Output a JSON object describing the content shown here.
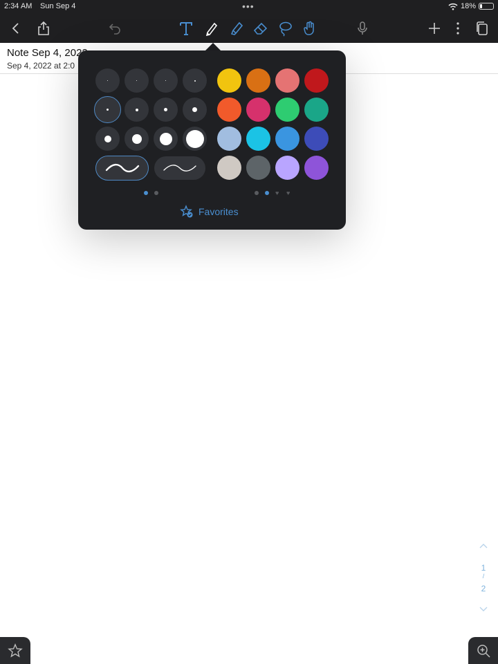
{
  "status": {
    "time": "2:34 AM",
    "date": "Sun Sep 4",
    "battery": "18%",
    "battery_level": 0.18
  },
  "toolbar": {
    "left": [
      "back-icon",
      "share-icon",
      "undo-icon"
    ],
    "tools": [
      "text-tool-icon",
      "pen-tool-icon",
      "highlighter-tool-icon",
      "eraser-tool-icon",
      "lasso-tool-icon",
      "hand-tool-icon"
    ],
    "selected_tool": "pen-tool-icon",
    "right": [
      "microphone-icon",
      "plus-icon",
      "more-icon",
      "pages-icon"
    ],
    "accent": "#4a8fd1"
  },
  "note": {
    "title": "Note Sep 4, 2022",
    "date": "Sep 4, 2022 at 2:0"
  },
  "popover": {
    "pen_sizes_selected": "row2-col1",
    "swatches": [
      [
        "#f1c40f",
        "#d97014",
        "#e57373",
        "#c0181c"
      ],
      [
        "#f15a2b",
        "#d6316c",
        "#2ecc71",
        "#1aa688"
      ],
      [
        "#a1bde0",
        "#1bc3e5",
        "#3a95e0",
        "#3d4cb8"
      ],
      [
        "#cfc9c3",
        "#5d6468",
        "#b9a5ff",
        "#8e54d9"
      ]
    ],
    "favorites_label": "Favorites",
    "pager_left": {
      "count": 2,
      "active": 0
    },
    "pager_right": {
      "count": 4,
      "active": 1
    }
  },
  "page_nav": {
    "current": "1",
    "total": "2"
  },
  "bottom": {
    "left_icon": "star-icon",
    "right_icon": "zoom-in-icon"
  }
}
